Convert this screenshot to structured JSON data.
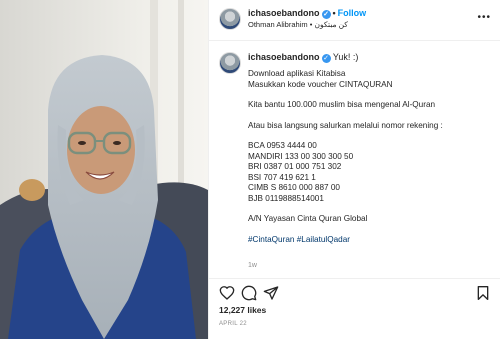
{
  "header": {
    "username": "ichasoebandono",
    "follow_label": "Follow",
    "separator": "•",
    "location": "Othman Alibrahim",
    "location_arabic": "كن مبتكون",
    "more_label": "•••"
  },
  "caption": {
    "username": "ichasoebandono",
    "reply_text": "Yuk! :)",
    "lines_1": [
      "Download aplikasi Kitabisa",
      "Masukkan kode voucher CINTAQURAN"
    ],
    "line_2": "Kita bantu 100.000 muslim bisa mengenal Al-Quran",
    "line_3": "Atau bisa langsung salurkan melalui nomor rekening :",
    "accounts": [
      "BCA 0953 4444 00",
      "MANDIRI 133 00 300 300 50",
      "BRI 0387 01 000 751 302",
      "BSI 707 419 621 1",
      "CIMB S 8610 000 887 00",
      "BJB 0119888514001"
    ],
    "account_name": "A/N Yayasan Cinta Quran Global",
    "hashtags": [
      "#CintaQuran",
      "#LailatulQadar"
    ],
    "time": "1w"
  },
  "actions": {
    "like_icon": "heart-icon",
    "comment_icon": "comment-icon",
    "share_icon": "share-icon",
    "save_icon": "bookmark-icon"
  },
  "likes_count": "12,227 likes",
  "post_date": "APRIL 22",
  "colors": {
    "link_blue": "#0095f6",
    "hashtag": "#00376b",
    "verified": "#3897f0",
    "muted": "#8e8e8e"
  }
}
